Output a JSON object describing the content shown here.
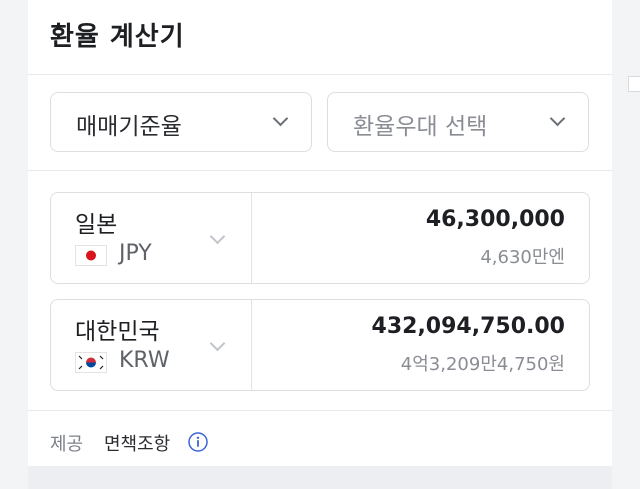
{
  "header": {
    "title": "환율 계산기"
  },
  "selectors": {
    "rate_type": {
      "value": "매매기준율",
      "icon": "chevron-down-icon"
    },
    "preference": {
      "placeholder": "환율우대 선택",
      "icon": "chevron-down-icon"
    }
  },
  "from_currency": {
    "name": "일본",
    "code": "JPY",
    "flag": "japan-flag-icon",
    "amount": "46,300,000",
    "amount_words": "4,630만엔"
  },
  "to_currency": {
    "name": "대한민국",
    "code": "KRW",
    "flag": "korea-flag-icon",
    "amount": "432,094,750.00",
    "amount_words": "4억3,209만4,750원"
  },
  "footer": {
    "provider_label": "제공",
    "disclaimer_link": "면책조항",
    "info_icon": "info-icon"
  },
  "colors": {
    "title_text": "#1d1f23",
    "border": "#dcdee2",
    "muted_text": "#8a8d93",
    "info_blue": "#3b63d9",
    "japan_red": "#d7141a",
    "korea_red": "#cd2e3a",
    "korea_blue": "#0047a0"
  }
}
